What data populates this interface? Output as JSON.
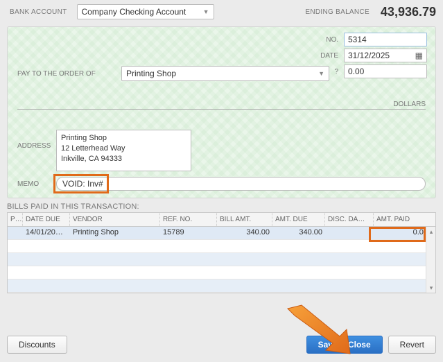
{
  "header": {
    "bank_account_label": "BANK ACCOUNT",
    "bank_account_value": "Company Checking Account",
    "ending_balance_label": "ENDING BALANCE",
    "ending_balance_value": "43,936.79"
  },
  "check": {
    "no_label": "NO.",
    "no_value": "5314",
    "date_label": "DATE",
    "date_value": "31/12/2025",
    "amount_label": "?",
    "amount_value": "0.00",
    "payto_label": "PAY TO THE ORDER OF",
    "payee": "Printing Shop",
    "dollars_label": "DOLLARS",
    "address_label": "ADDRESS",
    "address_text": "Printing Shop\n12 Letterhead Way\nInkville, CA 94333",
    "memo_label": "MEMO",
    "memo_value": "VOID: Inv#"
  },
  "bills": {
    "title": "BILLS PAID IN THIS TRANSACTION:",
    "columns": {
      "paid": "P…",
      "date_due": "DATE DUE",
      "vendor": "VENDOR",
      "ref_no": "REF. NO.",
      "bill_amt": "BILL AMT.",
      "amt_due": "AMT. DUE",
      "disc_date": "DISC. DA…",
      "amt_paid": "AMT. PAID"
    },
    "rows": [
      {
        "paid": "",
        "date_due": "14/01/20…",
        "vendor": "Printing Shop",
        "ref_no": "15789",
        "bill_amt": "340.00",
        "amt_due": "340.00",
        "disc_date": "",
        "amt_paid": "0.00"
      }
    ]
  },
  "buttons": {
    "discounts": "Discounts",
    "save_close": "Save & Close",
    "revert": "Revert"
  }
}
